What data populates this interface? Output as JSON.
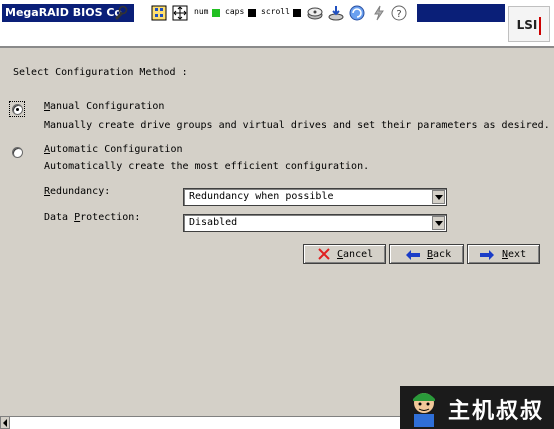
{
  "window": {
    "title": "MegaRAID BIOS Co",
    "logo_text": "LSI"
  },
  "toolbar": {
    "num_label": "num",
    "caps_label": "caps",
    "scroll_label": "scroll",
    "num_led_color": "#22c022",
    "caps_led_color": "#000000",
    "scroll_led_color": "#000000",
    "icons": [
      "tool-icon",
      "grid-icon",
      "move-icon",
      "disk-icon",
      "download-disk-icon",
      "refresh-icon",
      "flash-icon",
      "help-icon"
    ]
  },
  "main": {
    "heading": "Select Configuration Method :",
    "options": [
      {
        "title_prefix": "",
        "title_accel": "M",
        "title_rest": "anual Configuration",
        "description": "Manually create drive groups and virtual drives and set their parameters as desired.",
        "selected": true
      },
      {
        "title_prefix": "",
        "title_accel": "A",
        "title_rest": "utomatic Configuration",
        "description": "Automatically create the most efficient configuration.",
        "selected": false
      }
    ],
    "redundancy": {
      "label_prefix": "",
      "label_accel": "R",
      "label_rest": "edundancy:",
      "value": "Redundancy when possible"
    },
    "data_protection": {
      "label_prefix": "Data ",
      "label_accel": "P",
      "label_rest": "rotection:",
      "value": "Disabled"
    }
  },
  "buttons": {
    "cancel": {
      "accel": "C",
      "rest": "ancel"
    },
    "back": {
      "accel": "B",
      "rest": "ack"
    },
    "next": {
      "accel": "N",
      "rest": "ext"
    }
  },
  "watermark": {
    "text": "主机叔叔"
  },
  "colors": {
    "title_bg": "#0a1f78",
    "panel_bg": "#d4d0c8",
    "cancel_icon": "#e02020",
    "nav_icon": "#1a3cc8"
  }
}
